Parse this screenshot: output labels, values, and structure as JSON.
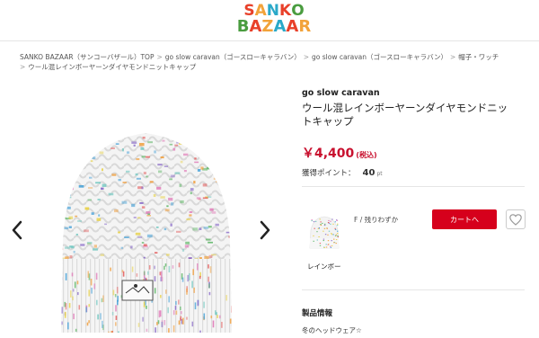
{
  "header": {
    "logo_line1": [
      "S",
      "A",
      "N",
      "K",
      "O"
    ],
    "logo_line2": [
      "B",
      "A",
      "Z",
      "A",
      "A",
      "R"
    ],
    "logo_colors1": [
      "#e8402a",
      "#f2a33a",
      "#2aa9c9",
      "#e8402a",
      "#4a9c3f"
    ],
    "logo_colors2": [
      "#4a9c3f",
      "#e8402a",
      "#f2a33a",
      "#2aa9c9",
      "#e8402a",
      "#f2a33a"
    ]
  },
  "breadcrumb": {
    "items": [
      "SANKO BAZAAR（サンコーバザール）TOP",
      "go slow caravan（ゴースローキャラバン）",
      "go slow caravan（ゴースローキャラバン）",
      "帽子・ワッチ",
      "ウール混レインボーヤーンダイヤモンドニットキャップ"
    ],
    "separator": ">"
  },
  "product": {
    "brand": "go slow caravan",
    "title": "ウール混レインボーヤーンダイヤモンドニットキャップ",
    "price": "￥4,400",
    "tax_label": "(税込)",
    "points_label": "獲得ポイント：",
    "points_value": "40",
    "points_unit": "pt",
    "variant_label": "レインボー",
    "stock_text": "F / 残りわずか",
    "cart_button": "カートへ",
    "info_heading": "製品情報",
    "info_text": "冬のヘッドウェア☆"
  },
  "icons": {
    "prev": "chevron-left-icon",
    "next": "chevron-right-icon",
    "favorite": "heart-icon"
  },
  "colors": {
    "accent": "#d6001c",
    "price": "#c8102e"
  }
}
